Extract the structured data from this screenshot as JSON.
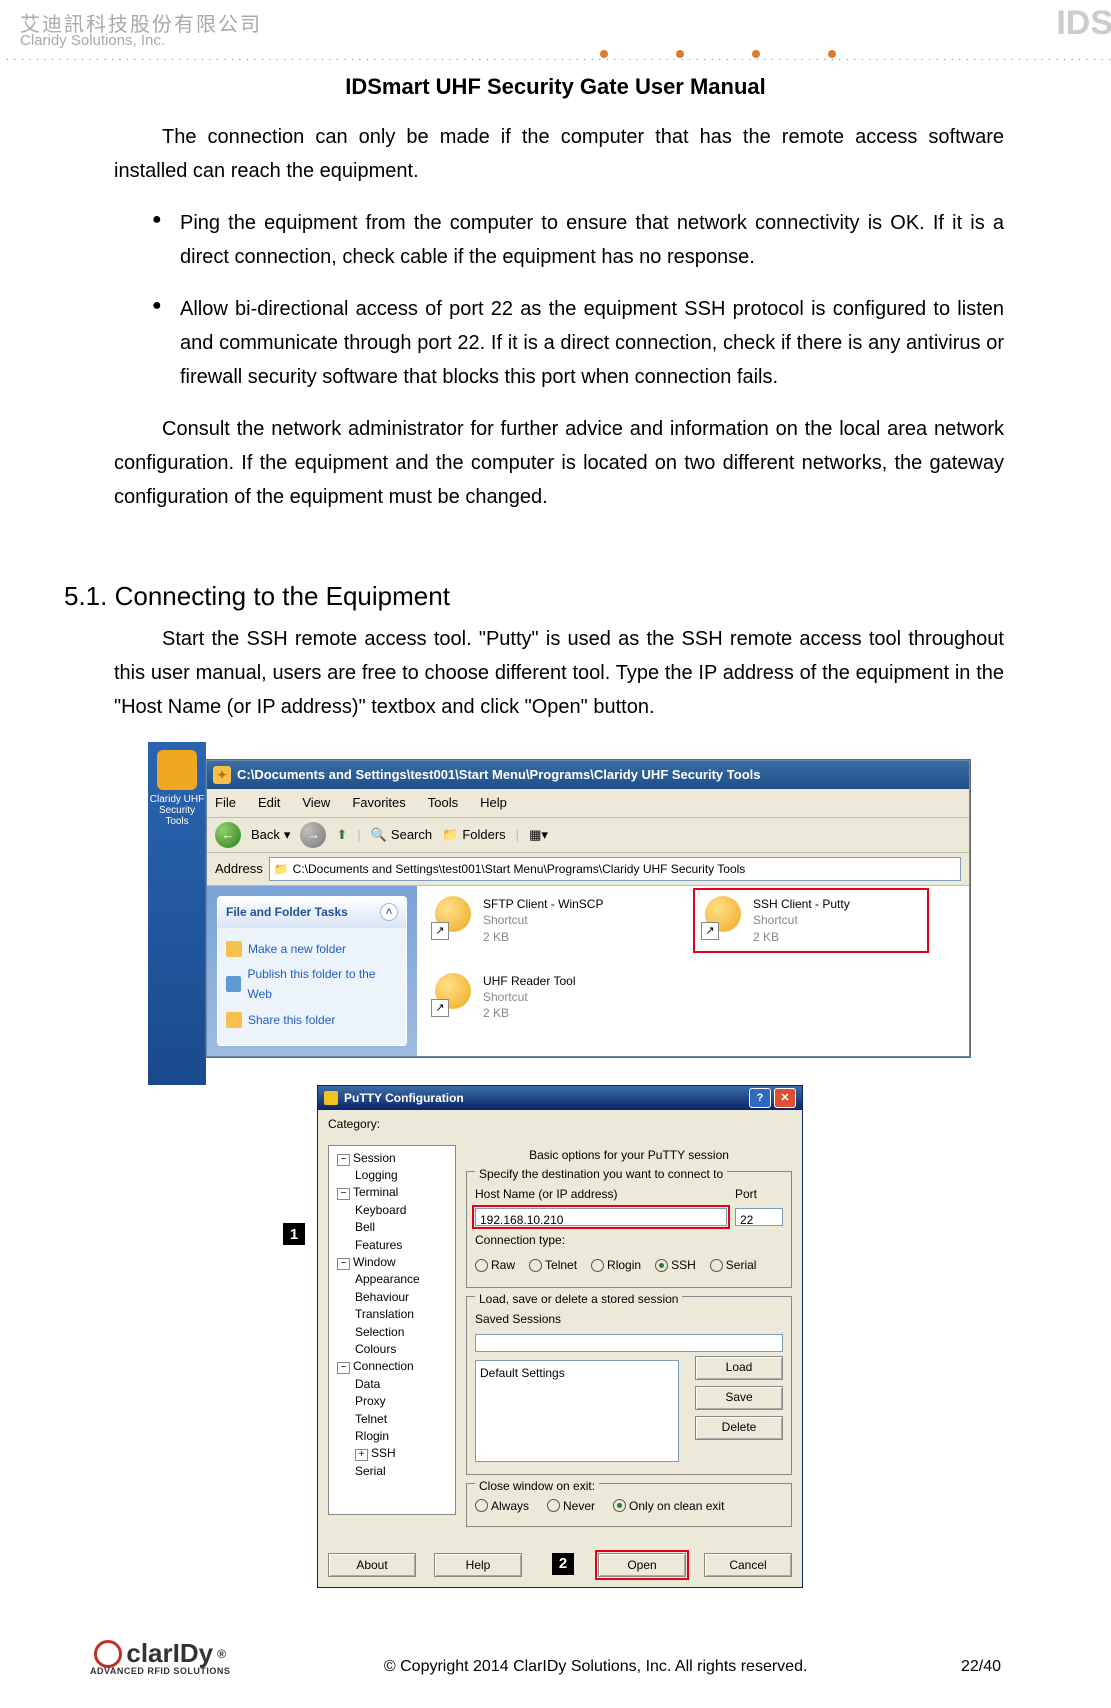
{
  "header": {
    "company_ch": "艾迪訊科技股份有限公司",
    "company_en": "Claridy Solutions, Inc.",
    "corner_logo": "IDS",
    "doc_title": "IDSmart UHF Security Gate User Manual"
  },
  "body": {
    "p1": "The connection can only be made if the computer that has the remote access software installed can reach the equipment.",
    "b1": "Ping the equipment from the computer to ensure that network connectivity is OK. If it is a direct connection, check cable if the equipment has no response.",
    "b2": "Allow bi-directional access of port 22 as the equipment SSH protocol is configured to listen and communicate through port 22. If it is a direct connection, check if there is any antivirus or firewall security software that blocks this port when connection fails.",
    "p2": "Consult the network administrator for further advice and information on the local area network configuration. If the equipment and the computer is located on two different networks, the gateway configuration of the equipment must be changed.",
    "h51": "5.1. Connecting to the Equipment",
    "p3": "Start the SSH remote access tool. \"Putty\" is used as the SSH remote access tool throughout this user manual, users are free to choose different tool. Type the IP address of the equipment in the \"Host Name (or IP address)\" textbox and click \"Open\" button."
  },
  "explorer": {
    "title": "C:\\Documents and Settings\\test001\\Start Menu\\Programs\\Claridy UHF Security Tools",
    "menus": [
      "File",
      "Edit",
      "View",
      "Favorites",
      "Tools",
      "Help"
    ],
    "back": "Back",
    "search": "Search",
    "folders": "Folders",
    "address_label": "Address",
    "address_value": "C:\\Documents and Settings\\test001\\Start Menu\\Programs\\Claridy UHF Security Tools",
    "launcher_label": "Claridy UHF Security Tools",
    "tasks_title": "File and Folder Tasks",
    "tasks": [
      "Make a new folder",
      "Publish this folder to the Web",
      "Share this folder"
    ],
    "files": [
      {
        "name": "SFTP Client - WinSCP",
        "sub1": "Shortcut",
        "sub2": "2 KB"
      },
      {
        "name": "SSH Client - Putty",
        "sub1": "Shortcut",
        "sub2": "2 KB"
      },
      {
        "name": "UHF Reader Tool",
        "sub1": "Shortcut",
        "sub2": "2 KB"
      }
    ]
  },
  "putty": {
    "title": "PuTTY Configuration",
    "category_label": "Category:",
    "tree": {
      "session": "Session",
      "logging": "Logging",
      "terminal": "Terminal",
      "keyboard": "Keyboard",
      "bell": "Bell",
      "features": "Features",
      "window": "Window",
      "appearance": "Appearance",
      "behaviour": "Behaviour",
      "translation": "Translation",
      "selection": "Selection",
      "colours": "Colours",
      "connection": "Connection",
      "data": "Data",
      "proxy": "Proxy",
      "telnet": "Telnet",
      "rlogin": "Rlogin",
      "ssh": "SSH",
      "serial": "Serial"
    },
    "panel_title": "Basic options for your PuTTY session",
    "grp1_legend": "Specify the destination you want to connect to",
    "host_label": "Host Name (or IP address)",
    "port_label": "Port",
    "host_value": "192.168.10.210",
    "port_value": "22",
    "conn_type_label": "Connection type:",
    "conn_types": [
      "Raw",
      "Telnet",
      "Rlogin",
      "SSH",
      "Serial"
    ],
    "conn_selected": "SSH",
    "grp2_legend": "Load, save or delete a stored session",
    "saved_label": "Saved Sessions",
    "default_item": "Default Settings",
    "btn_load": "Load",
    "btn_save": "Save",
    "btn_delete": "Delete",
    "grp3_legend": "Close window on exit:",
    "close_opts": [
      "Always",
      "Never",
      "Only on clean exit"
    ],
    "close_selected": "Only on clean exit",
    "btn_about": "About",
    "btn_help": "Help",
    "btn_open": "Open",
    "btn_cancel": "Cancel",
    "callout1": "1",
    "callout2": "2"
  },
  "footer": {
    "logo_text": "clarIDy",
    "logo_sub": "ADVANCED RFID SOLUTIONS",
    "reg": "®",
    "copyright": "© Copyright 2014 ClarIDy Solutions, Inc. All rights reserved.",
    "page": "22/40"
  }
}
